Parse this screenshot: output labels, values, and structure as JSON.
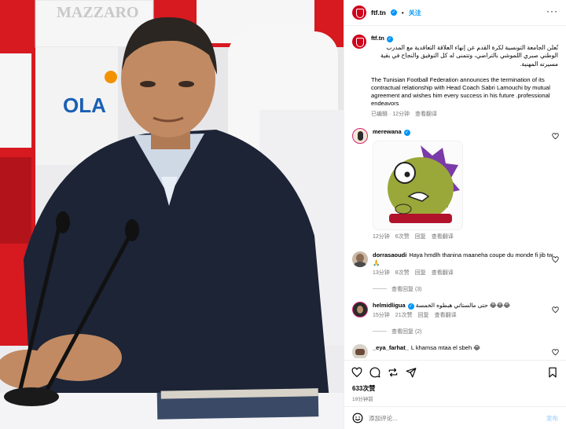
{
  "post": {
    "username": "ftf.tn",
    "follow_label": "关注",
    "caption_arabic": "تُعلن الجامعة التونسية لكرة القدم عن إنهاء العلاقة التعاقدية مع المدرب الوطني صبري اللموشي بالتراضي، وتتمنى له كل التوفيق والنجاح في بقية مسيرته المهنية.",
    "caption_english": "The Tunisian Football Federation announces the termination of its contractual relationship with Head Coach Sabri Lamouchi by mutual agreement and wishes him every success in his future .professional endeavors",
    "edited_label": "已编辑",
    "time": "12分钟",
    "translate_label": "查看翻译",
    "likes": "633次赞",
    "posted_ago": "19分钟前",
    "comment_placeholder": "添加评论...",
    "post_button": "发布"
  },
  "photo": {
    "sponsor_texts": [
      "MAZZARO",
      "OLA"
    ],
    "accent_color": "#d71920"
  },
  "comments": [
    {
      "user": "merewana",
      "verified": true,
      "text": "",
      "has_sticker": true,
      "time": "12分钟",
      "likes": "6次赞",
      "reply": "回复",
      "translate": "查看翻译",
      "view_replies": ""
    },
    {
      "user": "dorrasaoudi",
      "verified": false,
      "text": "Haya hmdlh thanina maaneha coupe du monde fi jib tw 🙏",
      "time": "13分钟",
      "likes": "8次赞",
      "reply": "回复",
      "translate": "查看翻译",
      "view_replies": "查看回复 (3)"
    },
    {
      "user": "helmidligua",
      "verified": true,
      "text": "حتى مالستاتي هبطوه الخمسة 😂😂😂",
      "time": "15分钟",
      "likes": "21次赞",
      "reply": "回复",
      "translate": "查看翻译",
      "view_replies": "查看回复 (2)"
    },
    {
      "user": "_eya_farhat_",
      "verified": false,
      "text": "L khamsa mtaa el sbeh 😂",
      "time": "",
      "likes": "",
      "reply": "",
      "translate": "",
      "view_replies": ""
    }
  ],
  "icons": [
    "heart-icon",
    "comment-icon",
    "repost-icon",
    "share-icon",
    "bookmark-icon",
    "more-icon",
    "emoji-icon"
  ],
  "colors": {
    "link": "#0095f6",
    "muted": "#737373",
    "brand_red": "#d0021b"
  }
}
